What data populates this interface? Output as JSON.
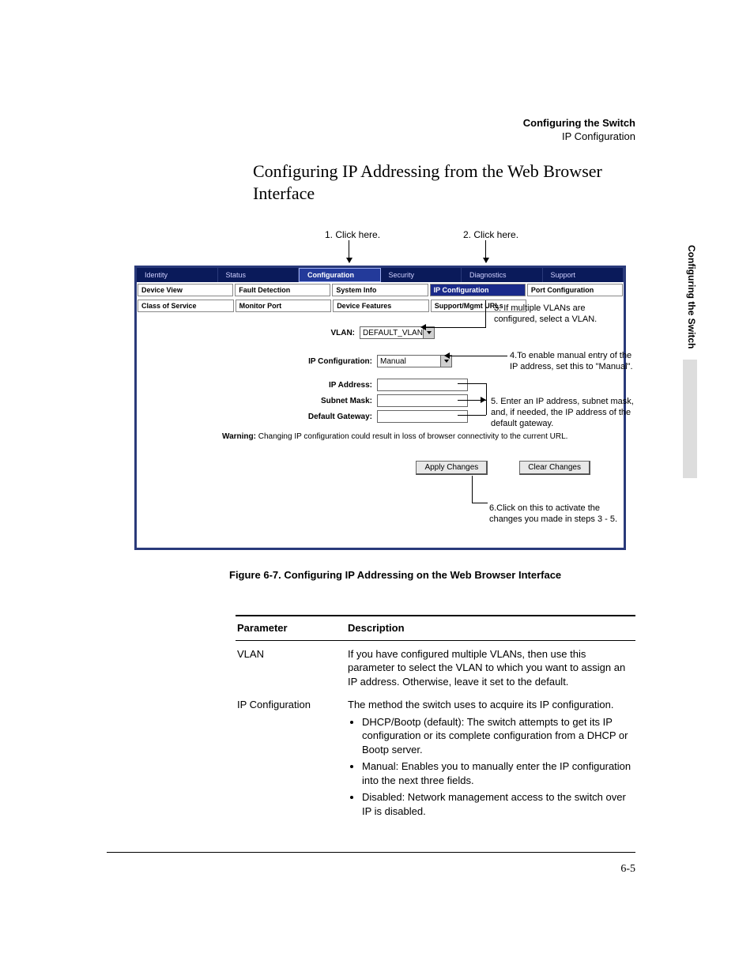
{
  "header": {
    "title_bold": "Configuring the Switch",
    "subtitle": "IP Configuration"
  },
  "section_title": "Configuring IP Addressing from the Web Browser Interface",
  "callouts": {
    "top1": "1. Click here.",
    "top2": "2. Click here.",
    "a3": "3. If multiple VLANs are configured, select a VLAN.",
    "a4": "4.To enable manual entry of the IP address, set this to \"Manual\".",
    "a5": "5. Enter an IP address, subnet mask, and, if needed, the IP address of the default gateway.",
    "a6": "6.Click on this to activate the changes you made in steps 3 - 5."
  },
  "tabs": [
    "Identity",
    "Status",
    "Configuration",
    "Security",
    "Diagnostics",
    "Support"
  ],
  "subtabs_row1": [
    "Device View",
    "Fault Detection",
    "System Info",
    "IP Configuration",
    "Port Configuration"
  ],
  "subtabs_row2": [
    "Class of Service",
    "Monitor Port",
    "Device Features",
    "Support/Mgmt URLs"
  ],
  "form": {
    "vlan_label": "VLAN:",
    "vlan_value": "DEFAULT_VLAN",
    "ipconf_label": "IP Configuration:",
    "ipconf_value": "Manual",
    "ipaddr_label": "IP Address:",
    "subnet_label": "Subnet Mask:",
    "gateway_label": "Default Gateway:"
  },
  "warning": {
    "bold": "Warning:",
    "text": " Changing IP configuration could result in loss of browser connectivity to the current URL."
  },
  "buttons": {
    "apply": "Apply Changes",
    "clear": "Clear Changes"
  },
  "figure_caption": "Figure 6-7.  Configuring IP Addressing on the Web Browser Interface",
  "table": {
    "headers": {
      "p": "Parameter",
      "d": "Description"
    },
    "rows": [
      {
        "p": "VLAN",
        "d": "If you have configured multiple VLANs, then use this parameter to select the VLAN to which you want to assign an IP address. Otherwise, leave it set to the default."
      },
      {
        "p": "IP Configuration",
        "d": "The method the switch uses to acquire its IP configuration.",
        "bullets": [
          "DHCP/Bootp (default): The switch attempts to get its IP configuration or its complete configuration from a DHCP or Bootp server.",
          "Manual: Enables you to manually enter the IP configuration into the next three fields.",
          "Disabled: Network management access to the switch over IP is disabled."
        ]
      }
    ]
  },
  "side_tab": "Configuring the Switch",
  "page_number": "6-5"
}
